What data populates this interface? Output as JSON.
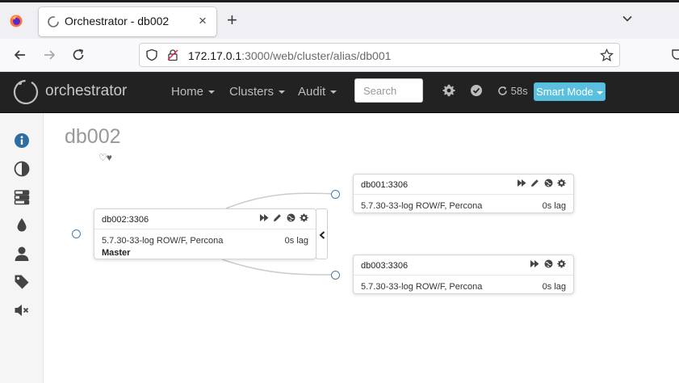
{
  "browser": {
    "tab_title": "Orchestrator - db002",
    "tab_close": "×",
    "new_tab": "+",
    "url_host": "172.17.0.1",
    "url_rest": ":3000/web/cluster/alias/db001"
  },
  "app": {
    "brand": "orchestrator",
    "menu": {
      "home": "Home",
      "clusters": "Clusters",
      "audit": "Audit"
    },
    "search_placeholder": "Search",
    "refresh_countdown": "58s",
    "mode_button": "Smart Mode"
  },
  "sidebar": {
    "icons": [
      "info-icon",
      "adjust-icon",
      "tasks-icon",
      "tint-icon",
      "user-icon",
      "tag-icon",
      "volume-off-icon"
    ]
  },
  "cluster": {
    "title": "db002",
    "hearts": "♡♥"
  },
  "nodes": {
    "master": {
      "name": "db002:3306",
      "version": "5.7.30-33-log ROW/F, Percona",
      "lag": "0s lag",
      "role": "Master"
    },
    "replica1": {
      "name": "db001:3306",
      "version": "5.7.30-33-log ROW/F, Percona",
      "lag": "0s lag"
    },
    "replica2": {
      "name": "db003:3306",
      "version": "5.7.30-33-log ROW/F, Percona",
      "lag": "0s lag"
    }
  },
  "colors": {
    "appbar_bg": "#222222",
    "accent_info": "#5bc0de",
    "sidebar_icon": "#444444",
    "sidebar_active_icon": "#2e6da4",
    "port_border": "#4a7aa8"
  }
}
